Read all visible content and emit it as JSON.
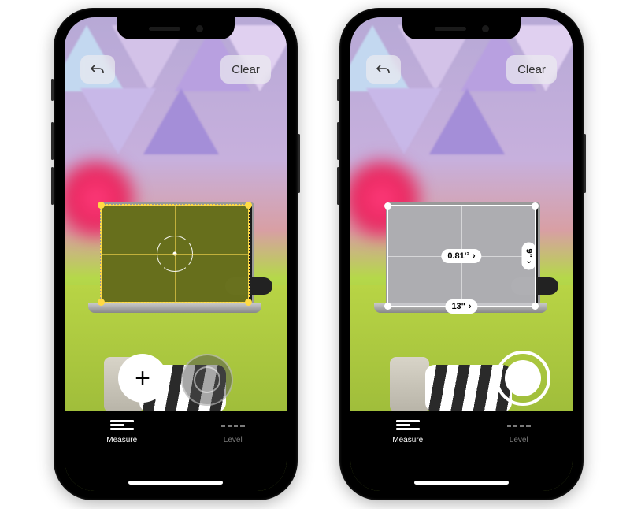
{
  "left": {
    "back_aria": "Undo",
    "clear_label": "Clear",
    "add_aria": "Add Point",
    "shutter_aria": "Capture",
    "tabs": {
      "measure": "Measure",
      "level": "Level"
    }
  },
  "right": {
    "back_aria": "Undo",
    "clear_label": "Clear",
    "shutter_aria": "Capture",
    "measurements": {
      "area": "0.81'²",
      "width": "13\"",
      "height": "9\""
    },
    "tabs": {
      "measure": "Measure",
      "level": "Level"
    }
  }
}
